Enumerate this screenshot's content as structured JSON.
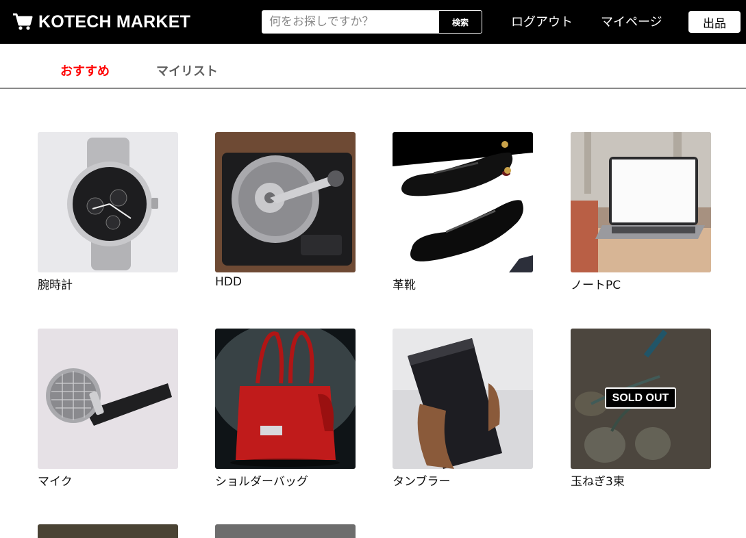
{
  "header": {
    "logo_icon": "cart-icon",
    "logo_text": "KOTECH MARKET",
    "search_placeholder": "何をお探しですか？",
    "search_button": "検索",
    "logout_label": "ログアウト",
    "mypage_label": "マイページ",
    "sell_label": "出品"
  },
  "tabs": {
    "recommended": "おすすめ",
    "mylist": "マイリスト",
    "active_color": "#ff0000"
  },
  "products": [
    {
      "name": "腕時計",
      "icon": "watch-image"
    },
    {
      "name": "HDD",
      "icon": "hdd-image"
    },
    {
      "name": "革靴",
      "icon": "shoes-image"
    },
    {
      "name": "ノートPC",
      "icon": "laptop-image"
    },
    {
      "name": "マイク",
      "icon": "microphone-image"
    },
    {
      "name": "ショルダーバッグ",
      "icon": "bag-image"
    },
    {
      "name": "タンブラー",
      "icon": "tumbler-image"
    },
    {
      "name": "玉ねぎ3束",
      "icon": "onion-image",
      "badge": "SOLD OUT"
    }
  ]
}
